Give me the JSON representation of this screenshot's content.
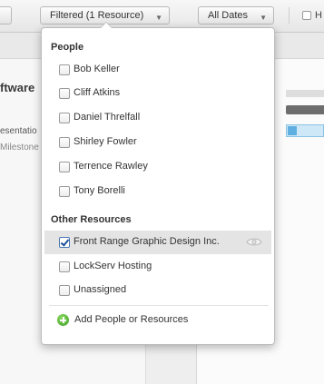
{
  "toolbar": {
    "filter_label": "Filtered (1 Resource)",
    "dates_label": "All Dates",
    "checkbox_label": "H"
  },
  "background": {
    "title": "ftware",
    "row1": "esentatio",
    "row2": "Milestone"
  },
  "dropdown": {
    "people_title": "People",
    "people": [
      {
        "label": "Bob Keller",
        "checked": false
      },
      {
        "label": "Cliff Atkins",
        "checked": false
      },
      {
        "label": "Daniel Threlfall",
        "checked": false
      },
      {
        "label": "Shirley Fowler",
        "checked": false
      },
      {
        "label": "Terrence Rawley",
        "checked": false
      },
      {
        "label": "Tony Borelli",
        "checked": false
      }
    ],
    "other_title": "Other Resources",
    "other": [
      {
        "label": "Front Range Graphic Design Inc.",
        "checked": true
      },
      {
        "label": "LockServ Hosting",
        "checked": false
      },
      {
        "label": "Unassigned",
        "checked": false
      }
    ],
    "add_label": "Add People or Resources"
  },
  "colors": {
    "selected_row": "#e4e4e4",
    "add_icon": "#4caf2e",
    "check_mark": "#1e4f9c"
  }
}
